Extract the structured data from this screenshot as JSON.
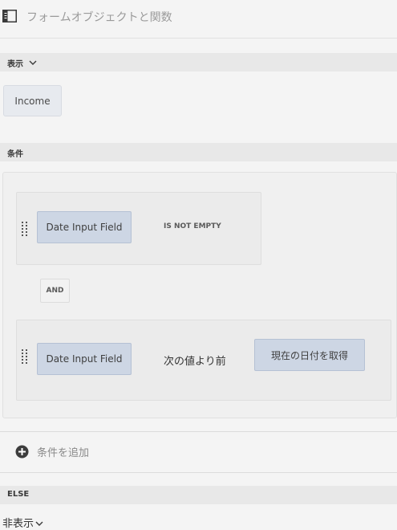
{
  "header": {
    "title": "フォームオブジェクトと関数",
    "icon": "panel-toggle-icon"
  },
  "action_section": {
    "label": "表示",
    "icon": "chevron-down-icon",
    "target": "Income"
  },
  "condition_section": {
    "label": "条件",
    "conditions": [
      {
        "field": "Date Input Field",
        "operator": "IS NOT EMPTY"
      },
      {
        "field": "Date Input Field",
        "operator": "次の値より前",
        "value": "現在の日付を取得"
      }
    ],
    "joiner": "AND",
    "add_label": "条件を追加",
    "add_icon": "add-circle-icon"
  },
  "else_section": {
    "label": "ELSE",
    "value": "非表示",
    "icon": "chevron-down-icon"
  },
  "colors": {
    "field_chip": "#cdd6e4",
    "section_header": "#e8e8e8",
    "background": "#f4f4f4"
  }
}
